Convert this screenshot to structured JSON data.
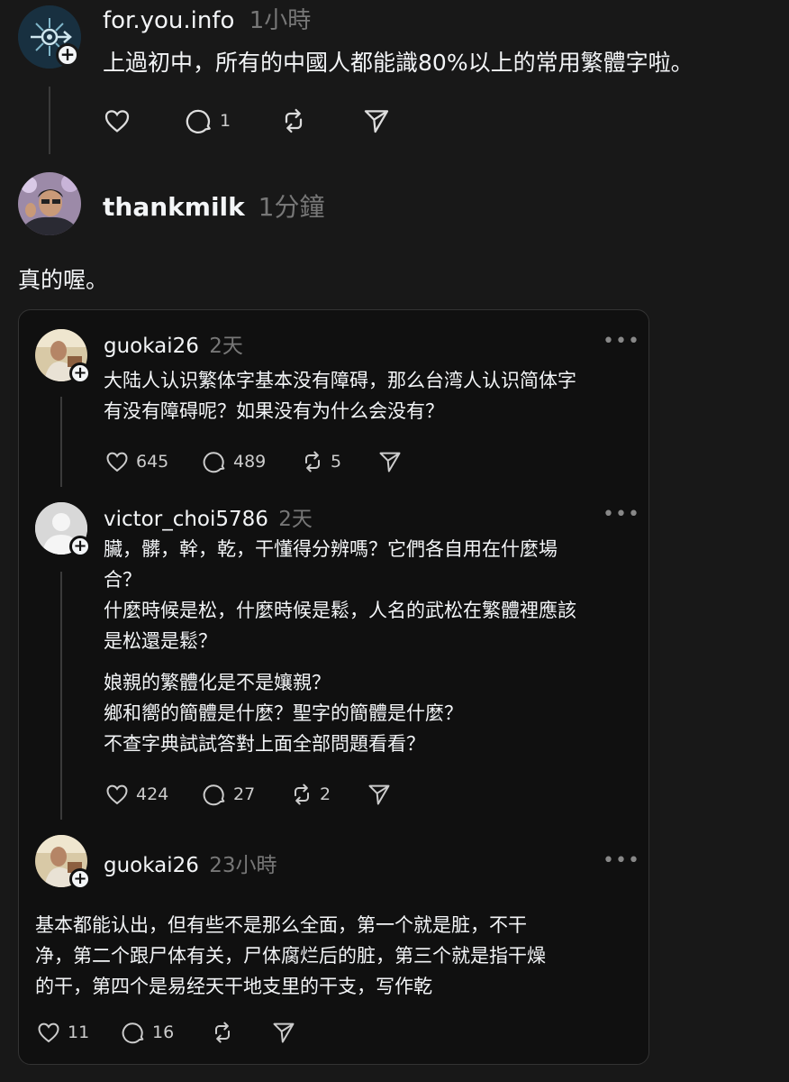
{
  "top_post": {
    "username": "for.you.info",
    "time": "1小時",
    "text": "上過初中，所有的中國人都能識80%以上的常用繁體字啦。",
    "reply_count": "1"
  },
  "reply_post": {
    "username": "thankmilk",
    "time": "1分鐘",
    "text": "真的喔。"
  },
  "quoted": {
    "post1": {
      "username": "guokai26",
      "time": "2天",
      "lines": [
        "大陆人认识繁体字基本没有障碍，那么台湾人认识简体字",
        "有没有障碍呢？如果没有为什么会没有？"
      ],
      "likes": "645",
      "replies": "489",
      "reposts": "5"
    },
    "post2": {
      "username": "victor_choi5786",
      "time": "2天",
      "lines": [
        "臟，髒，幹，乾，干懂得分辨嗎？它們各自用在什麼場",
        "合？",
        "什麼時候是松，什麼時候是鬆，人名的武松在繁體裡應該",
        "是松還是鬆？",
        "娘親的繁體化是不是孃親？",
        "鄉和嚮的簡體是什麼？聖字的簡體是什麼？",
        "不查字典試試答對上面全部問題看看？"
      ],
      "likes": "424",
      "replies": "27",
      "reposts": "2"
    },
    "post3": {
      "username": "guokai26",
      "time": "23小時",
      "lines": [
        "基本都能认出，但有些不是那么全面，第一个就是脏，不干",
        "净，第二个跟尸体有关，尸体腐烂后的脏，第三个就是指干燥",
        "的干，第四个是易经天干地支里的干支，写作乾"
      ],
      "likes": "11",
      "replies": "16"
    },
    "more_label": "•••"
  },
  "icons": {
    "like": "heart-icon",
    "reply": "comment-icon",
    "repost": "repost-icon",
    "share": "send-icon",
    "follow": "plus-icon"
  },
  "colors": {
    "background": "#181818",
    "card_background": "#101010",
    "text": "#f3f5f7",
    "muted": "#777777"
  }
}
